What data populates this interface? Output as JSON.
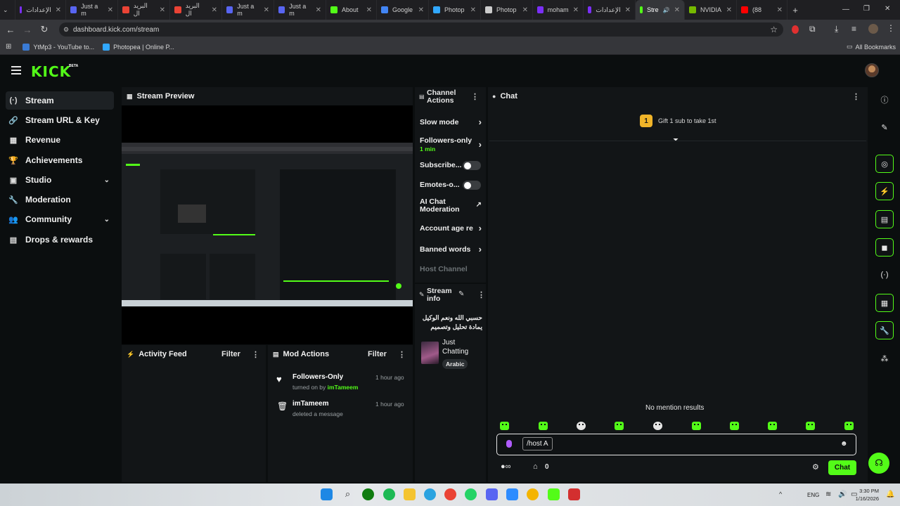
{
  "browser": {
    "tabs": [
      {
        "label": "الإعدادات",
        "color": "#7b2ff7"
      },
      {
        "label": "Just a m",
        "color": "#5865f2"
      },
      {
        "label": "البريد ال",
        "color": "#ea4335"
      },
      {
        "label": "البريد ال",
        "color": "#ea4335"
      },
      {
        "label": "Just a m",
        "color": "#5865f2"
      },
      {
        "label": "Just a m",
        "color": "#5865f2"
      },
      {
        "label": "About",
        "color": "#53fc18"
      },
      {
        "label": "Google",
        "color": "#4285f4"
      },
      {
        "label": "Photop",
        "color": "#31a8ff"
      },
      {
        "label": "Photop",
        "color": "#cccccc"
      },
      {
        "label": "moham",
        "color": "#7b2ff7"
      },
      {
        "label": "الإعدادات",
        "color": "#7b2ff7"
      },
      {
        "label": "Stre",
        "color": "#53fc18",
        "active": true
      },
      {
        "label": "NVIDIA",
        "color": "#76b900"
      },
      {
        "label": "(88",
        "color": "#ff0000"
      }
    ],
    "url": "dashboard.kick.com/stream",
    "bookmarks": [
      {
        "label": "YtMp3 - YouTube to...",
        "color": "#3a7bd5"
      },
      {
        "label": "Photopea | Online P...",
        "color": "#31a8ff"
      }
    ],
    "all_bookmarks": "All Bookmarks"
  },
  "header": {
    "logo": "KICK",
    "beta": "BETA"
  },
  "sidebar": {
    "items": [
      {
        "label": "Stream",
        "icon": "(·)"
      },
      {
        "label": "Stream URL & Key",
        "icon": "🔗"
      },
      {
        "label": "Revenue",
        "icon": "▦"
      },
      {
        "label": "Achievements",
        "icon": "🏆"
      },
      {
        "label": "Studio",
        "icon": "▣"
      },
      {
        "label": "Moderation",
        "icon": "🔧"
      },
      {
        "label": "Community",
        "icon": "👥"
      },
      {
        "label": "Drops & rewards",
        "icon": "▤"
      }
    ]
  },
  "stream_preview": {
    "title": "Stream Preview"
  },
  "activity_feed": {
    "title": "Activity Feed",
    "filter": "Filter"
  },
  "mod_actions": {
    "title": "Mod Actions",
    "filter": "Filter",
    "entries": [
      {
        "title": "Followers-Only",
        "prefix": "turned on by",
        "user": "imTameem",
        "time": "1 hour ago"
      },
      {
        "title": "imTameem",
        "prefix": "deleted a message",
        "user": "",
        "time": "1 hour ago"
      }
    ]
  },
  "channel_actions": {
    "title_line1": "Channel",
    "title_line2": "Actions",
    "slow_mode": "Slow mode",
    "followers_only": "Followers-only",
    "followers_only_value": "1 min",
    "subscribers": "Subscribe...",
    "emotes": "Emotes-o...",
    "ai_line1": "AI Chat",
    "ai_line2": "Moderation",
    "account_age": "Account age re",
    "banned_words": "Banned words",
    "host_channel": "Host Channel"
  },
  "stream_info": {
    "title_line1": "Stream",
    "title_line2": "info",
    "stream_title": "حسبي الله ونعم الوكيل يمادة تحليل وتصميم",
    "category_line1": "Just",
    "category_line2": "Chatting",
    "tag": "Arabic"
  },
  "chat": {
    "title": "Chat",
    "gift_rank": "1",
    "gift_text": "Gift 1 sub to take 1st",
    "no_mention": "No mention results",
    "input_command": "/host A",
    "points_count": "0",
    "send_label": "Chat"
  },
  "taskbar": {
    "lang": "ENG",
    "time": "3:30 PM",
    "date": "1/16/2026"
  },
  "colors": {
    "accent": "#53fc18",
    "bg": "#0b0e0f",
    "panel": "#121517"
  }
}
